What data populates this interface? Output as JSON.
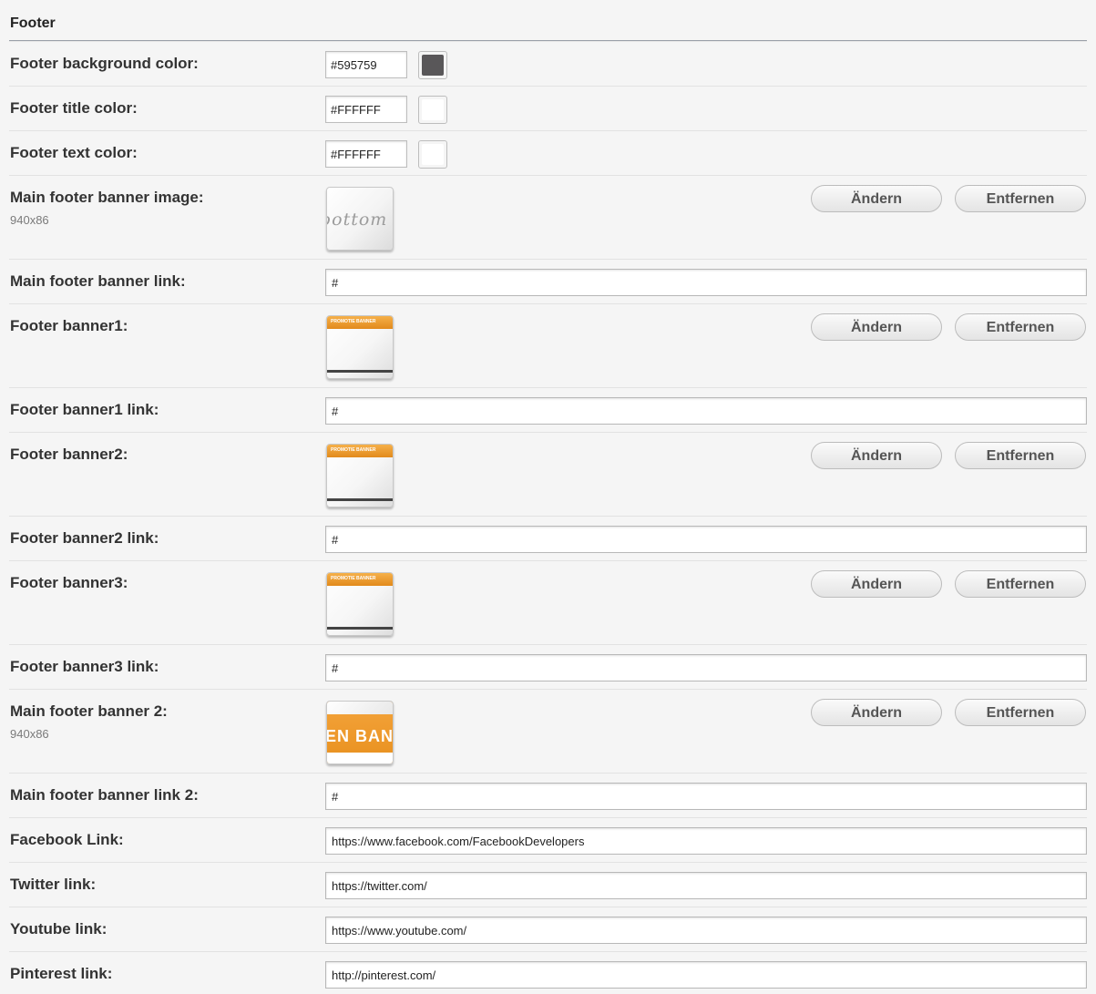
{
  "section": {
    "title": "Footer"
  },
  "colors": [
    {
      "label": "Footer background color:",
      "value": "#595759",
      "swatch": "#595759"
    },
    {
      "label": "Footer title color:",
      "value": "#FFFFFF",
      "swatch": "#FFFFFF"
    },
    {
      "label": "Footer text color:",
      "value": "#FFFFFF",
      "swatch": "#FFFFFF"
    }
  ],
  "main_banner": {
    "label": "Main footer banner image:",
    "size": "940x86",
    "thumb_text": "bottom",
    "change_label": "Ändern",
    "remove_label": "Entfernen"
  },
  "main_banner_link": {
    "label": "Main footer banner link:",
    "value": "#"
  },
  "banner1": {
    "label": "Footer banner1:",
    "thumb_text": "PROMOTIE BANNER",
    "change_label": "Ändern",
    "remove_label": "Entfernen"
  },
  "banner1_link": {
    "label": "Footer banner1 link:",
    "value": "#"
  },
  "banner2": {
    "label": "Footer banner2:",
    "thumb_text": "PROMOTIE BANNER",
    "change_label": "Ändern",
    "remove_label": "Entfernen"
  },
  "banner2_link": {
    "label": "Footer banner2 link:",
    "value": "#"
  },
  "banner3": {
    "label": "Footer banner3:",
    "thumb_text": "PROMOTIE BANNER",
    "change_label": "Ändern",
    "remove_label": "Entfernen"
  },
  "banner3_link": {
    "label": "Footer banner3 link:",
    "value": "#"
  },
  "main_banner2": {
    "label": "Main footer banner 2:",
    "size": "940x86",
    "thumb_text": "EN BAN",
    "change_label": "Ändern",
    "remove_label": "Entfernen"
  },
  "main_banner2_link": {
    "label": "Main footer banner link 2:",
    "value": "#"
  },
  "social": {
    "facebook": {
      "label": "Facebook Link:",
      "value": "https://www.facebook.com/FacebookDevelopers"
    },
    "twitter": {
      "label": "Twitter link:",
      "value": "https://twitter.com/"
    },
    "youtube": {
      "label": "Youtube link:",
      "value": "https://www.youtube.com/"
    },
    "pinterest": {
      "label": "Pinterest link:",
      "value": "http://pinterest.com/"
    }
  },
  "palette": {
    "accent_orange": "#f0a030",
    "rule": "#9aa0a8"
  }
}
